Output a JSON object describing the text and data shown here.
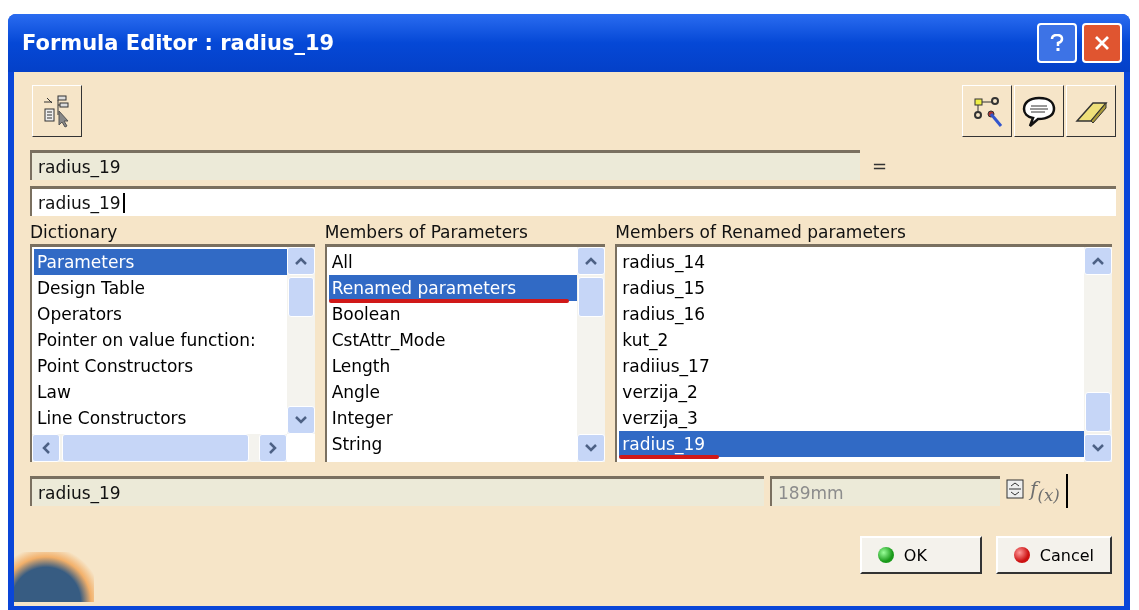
{
  "window": {
    "title": "Formula Editor : radius_19"
  },
  "parameter_field": {
    "value": "radius_19"
  },
  "equals_sign": "=",
  "formula_field": {
    "value": "radius_19 "
  },
  "lists": [
    {
      "label": "Dictionary",
      "kind": "hscroll",
      "items": [
        {
          "text": "Parameters",
          "selected": true,
          "underlined": false
        },
        {
          "text": "Design Table",
          "selected": false,
          "underlined": false
        },
        {
          "text": "Operators",
          "selected": false,
          "underlined": false
        },
        {
          "text": "Pointer on value function:",
          "selected": false,
          "underlined": false
        },
        {
          "text": "Point Constructors",
          "selected": false,
          "underlined": false
        },
        {
          "text": "Law",
          "selected": false,
          "underlined": false
        },
        {
          "text": "Line Constructors",
          "selected": false,
          "underlined": false
        }
      ]
    },
    {
      "label": "Members of Parameters",
      "kind": "plain",
      "items": [
        {
          "text": "All",
          "selected": false,
          "underlined": false
        },
        {
          "text": "Renamed parameters",
          "selected": true,
          "underlined": true
        },
        {
          "text": "Boolean",
          "selected": false,
          "underlined": false
        },
        {
          "text": "CstAttr_Mode",
          "selected": false,
          "underlined": false
        },
        {
          "text": "Length",
          "selected": false,
          "underlined": false
        },
        {
          "text": "Angle",
          "selected": false,
          "underlined": false
        },
        {
          "text": "Integer",
          "selected": false,
          "underlined": false
        },
        {
          "text": "String",
          "selected": false,
          "underlined": false
        }
      ]
    },
    {
      "label": "Members of Renamed parameters",
      "kind": "plain",
      "items": [
        {
          "text": "radius_14",
          "selected": false,
          "underlined": false
        },
        {
          "text": "radius_15",
          "selected": false,
          "underlined": false
        },
        {
          "text": "radius_16",
          "selected": false,
          "underlined": false
        },
        {
          "text": "kut_2",
          "selected": false,
          "underlined": false
        },
        {
          "text": "radiius_17",
          "selected": false,
          "underlined": false
        },
        {
          "text": "verzija_2",
          "selected": false,
          "underlined": false
        },
        {
          "text": "verzija_3",
          "selected": false,
          "underlined": false
        },
        {
          "text": "radius_19",
          "selected": true,
          "underlined": true
        }
      ]
    }
  ],
  "name_field": {
    "value": "radius_19"
  },
  "value_field": {
    "value": "189mm",
    "disabled": true
  },
  "formula_label": "f$_{(x)}$",
  "buttons": [
    {
      "label": "OK",
      "kind": "ok"
    },
    {
      "label": "Cancel",
      "kind": "cancel"
    }
  ]
}
